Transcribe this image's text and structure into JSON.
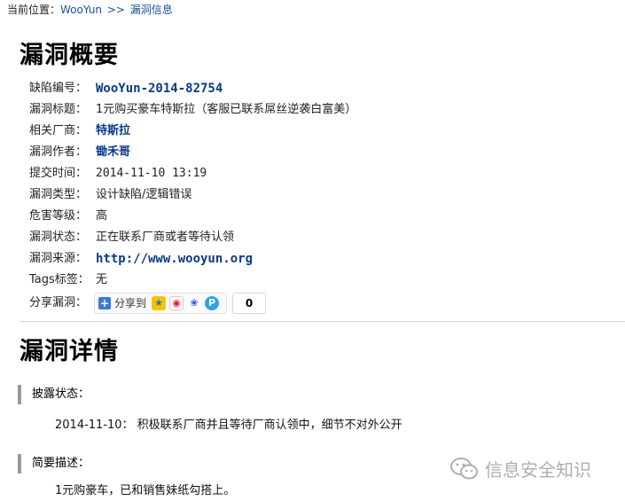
{
  "breadcrumb": {
    "prefix": "当前位置：",
    "home": "WooYun",
    "separator": ">>",
    "current": "漏洞信息"
  },
  "summary": {
    "title": "漏洞概要",
    "rows": [
      {
        "label": "缺陷编号：",
        "value": "WooYun-2014-82754"
      },
      {
        "label": "漏洞标题：",
        "value": "1元购买豪车特斯拉（客服已联系屌丝逆袭白富美）"
      },
      {
        "label": "相关厂商：",
        "value": "特斯拉"
      },
      {
        "label": "漏洞作者：",
        "value": "锄禾哥"
      },
      {
        "label": "提交时间：",
        "value": "2014-11-10 13:19"
      },
      {
        "label": "漏洞类型：",
        "value": "设计缺陷/逻辑错误"
      },
      {
        "label": "危害等级：",
        "value": "高"
      },
      {
        "label": "漏洞状态：",
        "value": "正在联系厂商或者等待认领"
      },
      {
        "label": "漏洞来源：",
        "value": "http://www.wooyun.org"
      },
      {
        "label": "Tags标签：",
        "value": "无"
      }
    ],
    "share": {
      "label": "分享漏洞：",
      "button_text": "分享到",
      "icons": [
        "qzone-icon",
        "weibo-icon",
        "baidu-icon",
        "pinterest-icon"
      ],
      "count": "0"
    }
  },
  "details": {
    "title": "漏洞详情",
    "disclosure": {
      "heading": "披露状态：",
      "text": "2014-11-10： 积极联系厂商并且等待厂商认领中，细节不对外公开"
    },
    "brief": {
      "heading": "简要描述：",
      "text": "1元购豪车，已和销售妹纸勾搭上。"
    }
  },
  "watermark": {
    "text": "信息安全知识",
    "icon": "wechat-icon"
  },
  "colors": {
    "link": "#1a4fa0",
    "bold_link": "#0a3a8a",
    "divider": "#d6d6d6",
    "section_bar": "#999999",
    "watermark": "#aab0b6"
  }
}
